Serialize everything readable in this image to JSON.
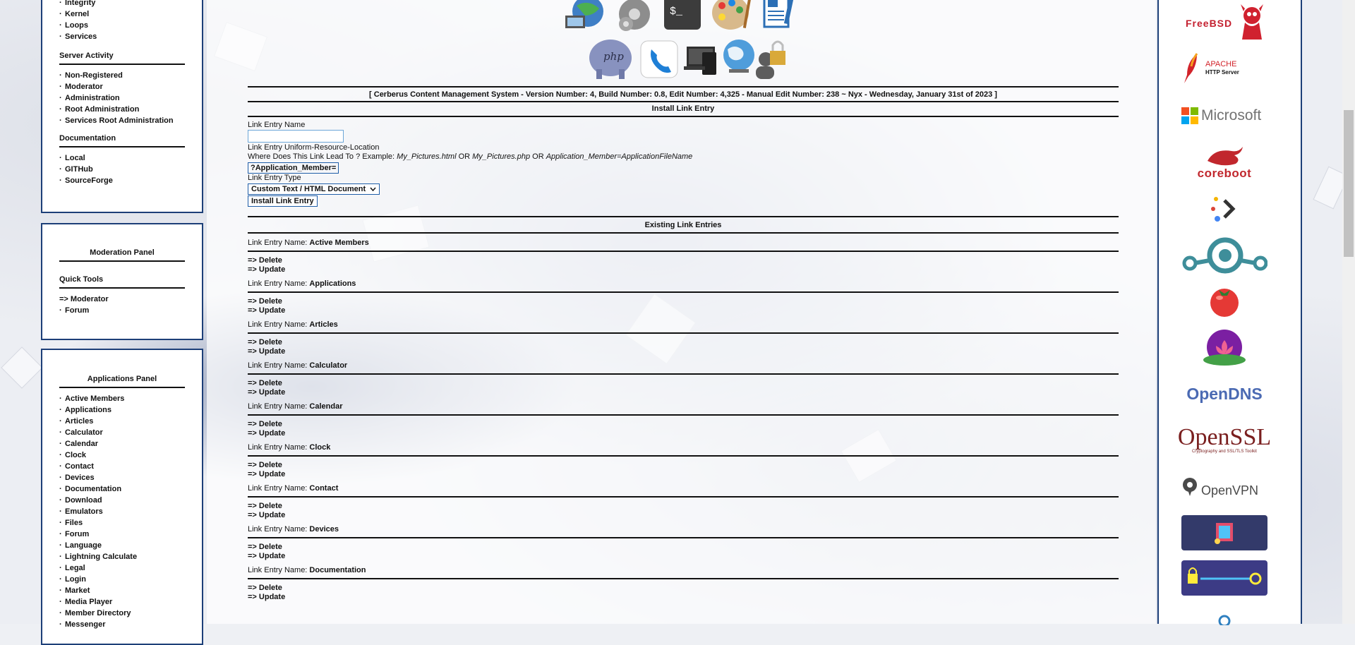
{
  "left_panel_top": {
    "items_1": [
      "Integrity",
      "Kernel",
      "Loops",
      "Services"
    ],
    "server_activity_title": "Server Activity",
    "server_activity": [
      "Non-Registered",
      "Moderator",
      "Administration",
      "Root Administration",
      "Services Root Administration"
    ],
    "documentation_title": "Documentation",
    "documentation": [
      "Local",
      "GITHub",
      "SourceForge"
    ]
  },
  "moderation_panel": {
    "title": "Moderation Panel",
    "quick_tools_title": "Quick Tools",
    "moderator_link": "=> Moderator",
    "forum_link": "Forum"
  },
  "applications_panel": {
    "title": "Applications Panel",
    "items": [
      "Active Members",
      "Applications",
      "Articles",
      "Calculator",
      "Calendar",
      "Clock",
      "Contact",
      "Devices",
      "Documentation",
      "Download",
      "Emulators",
      "Files",
      "Forum",
      "Language",
      "Lightning Calculate",
      "Legal",
      "Login",
      "Market",
      "Media Player",
      "Member Directory",
      "Messenger"
    ]
  },
  "header": {
    "version_line": "[ Cerberus Content Management System - Version Number: 4, Build Number: 0.8, Edit Number: 4,325 - Manual Edit Number: 238 ~ Nyx - Wednesday, January 31st of 2023 ]",
    "icons_row1": [
      "globe-network-icon",
      "gears-icon",
      "terminal-icon",
      "palette-icon",
      "document-edit-icon"
    ],
    "icons_row2": [
      "php-elephant-icon",
      "phone-icon",
      "devices-icon",
      "globe-icon",
      "user-lock-icon"
    ],
    "terminal_glyph": "$_",
    "php_glyph": "php"
  },
  "install_form": {
    "title": "Install Link Entry",
    "name_label": "Link Entry Name",
    "name_value": "",
    "url_label": "Link Entry Uniform-Resource-Location",
    "url_hint_prefix": "Where Does This Link Lead To ? Example: ",
    "url_hint_ex1": "My_Pictures.html",
    "url_hint_or1": " OR ",
    "url_hint_ex2": "My_Pictures.php",
    "url_hint_or2": " OR ",
    "url_hint_ex3": "Application_Member=ApplicationFileName",
    "url_prefix": "?Application_Member=",
    "type_label": "Link Entry Type",
    "type_selected": "Custom Text / HTML Document",
    "submit_label": "Install Link Entry"
  },
  "existing": {
    "title": "Existing Link Entries",
    "name_prefix": "Link Entry Name: ",
    "delete_label": "=> Delete",
    "update_label": "=> Update",
    "entries": [
      "Active Members",
      "Applications",
      "Articles",
      "Calculator",
      "Calendar",
      "Clock",
      "Contact",
      "Devices",
      "Documentation"
    ]
  },
  "right_logos": {
    "freebsd": "FreeBSD",
    "apache": "APACHE",
    "apache_sub": "HTTP Server",
    "microsoft": "Microsoft",
    "coreboot": "coreboot",
    "opendns": "OpenDNS",
    "openssl": "OpenSSL",
    "openssl_sub": "Cryptography and SSL/TLS Toolkit",
    "openvpn": "OpenVPN"
  },
  "colors": {
    "panel_border": "#1d3f78",
    "link_blue": "#1f5ea8",
    "freebsd_red": "#c4202f",
    "microsoft_grey": "#737373",
    "coreboot_red": "#c1272d",
    "opendns_blue": "#4b6ab3",
    "openssl_maroon": "#7a1f1f",
    "openvpn_grey": "#4a4a4a",
    "teal_logo": "#3e8e9a"
  }
}
